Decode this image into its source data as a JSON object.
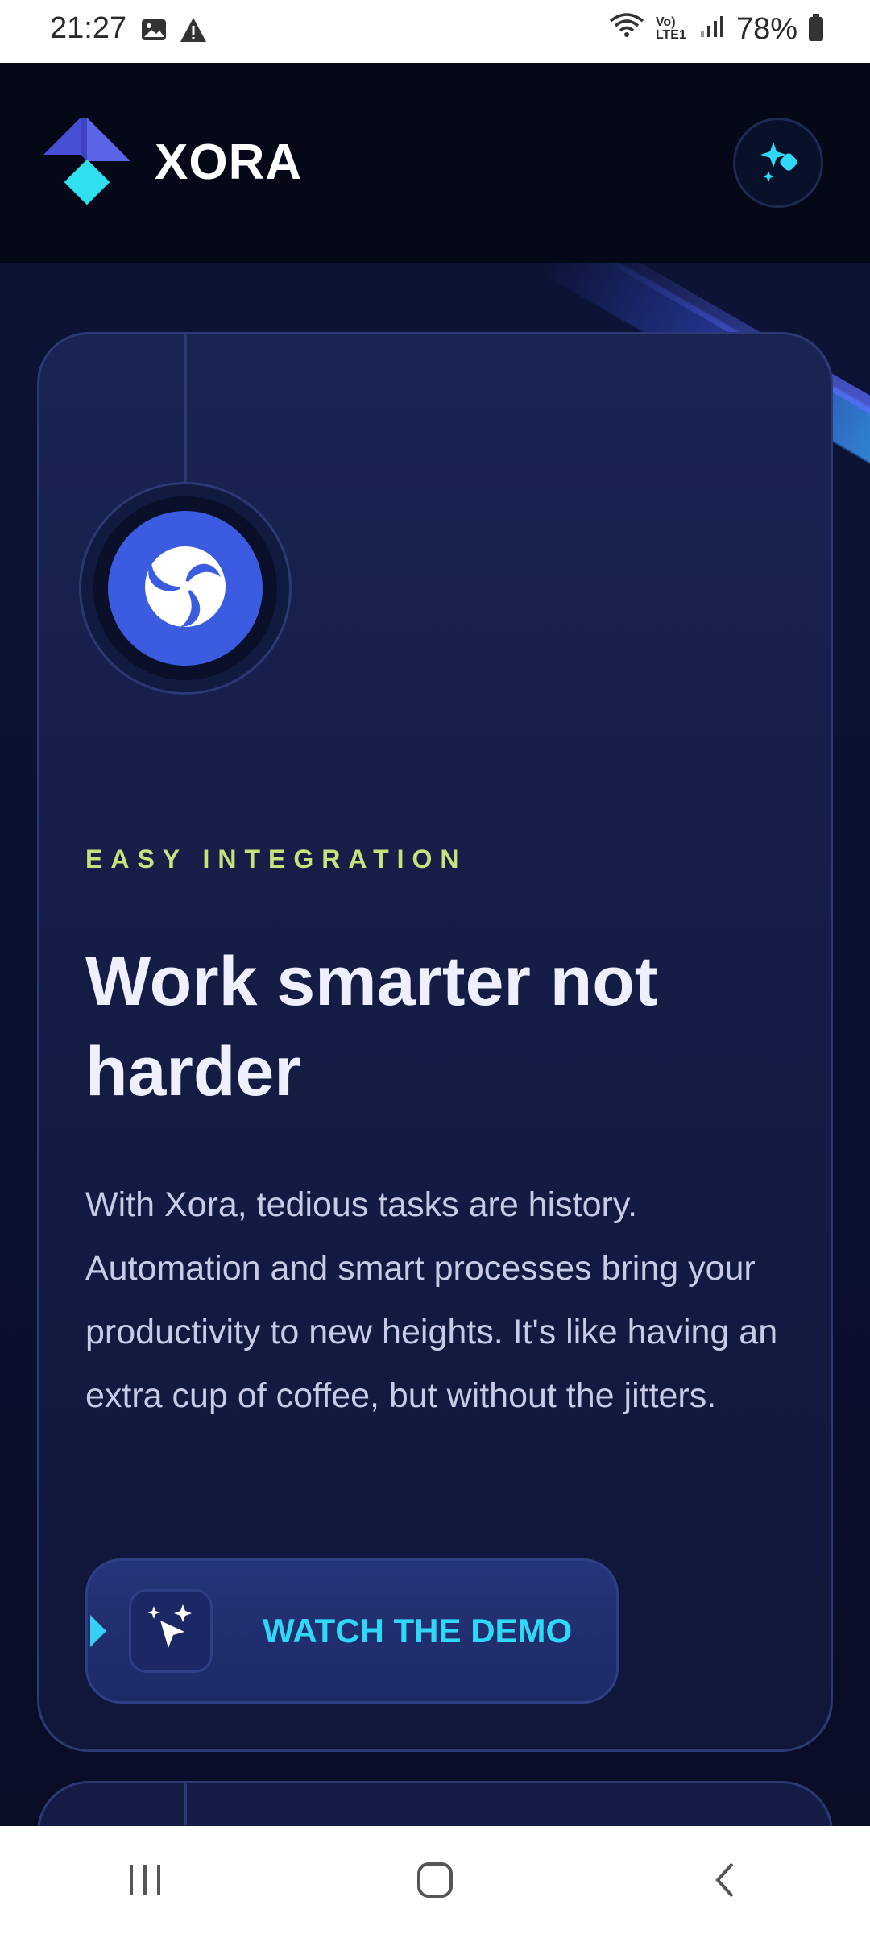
{
  "status_bar": {
    "time": "21:27",
    "network": "Vo) LTE1",
    "battery": "78%",
    "icons": [
      "image-icon",
      "warning-icon",
      "wifi-icon",
      "signal-icon",
      "battery-icon"
    ]
  },
  "header": {
    "brand": "XORA",
    "menu_icon": "sparkle-icon"
  },
  "feature_card": {
    "eyebrow": "EASY INTEGRATION",
    "title": "Work smarter not harder",
    "description": "With Xora, tedious tasks are history. Automation and smart processes bring your productivity to new heights. It's like having an extra cup of coffee, but without the jitters.",
    "cta_label": "WATCH THE DEMO",
    "cta_icon": "magic-cursor-icon",
    "feature_icon": "swirl-icon"
  },
  "colors": {
    "background": "#0c1335",
    "card": "#1a2453",
    "accent_cyan": "#2fd9f5",
    "eyebrow_green": "#c6e27c",
    "brand_blue": "#3b5ce0"
  },
  "nav_bar": {
    "items": [
      "recent-apps-icon",
      "home-icon",
      "back-icon"
    ]
  }
}
